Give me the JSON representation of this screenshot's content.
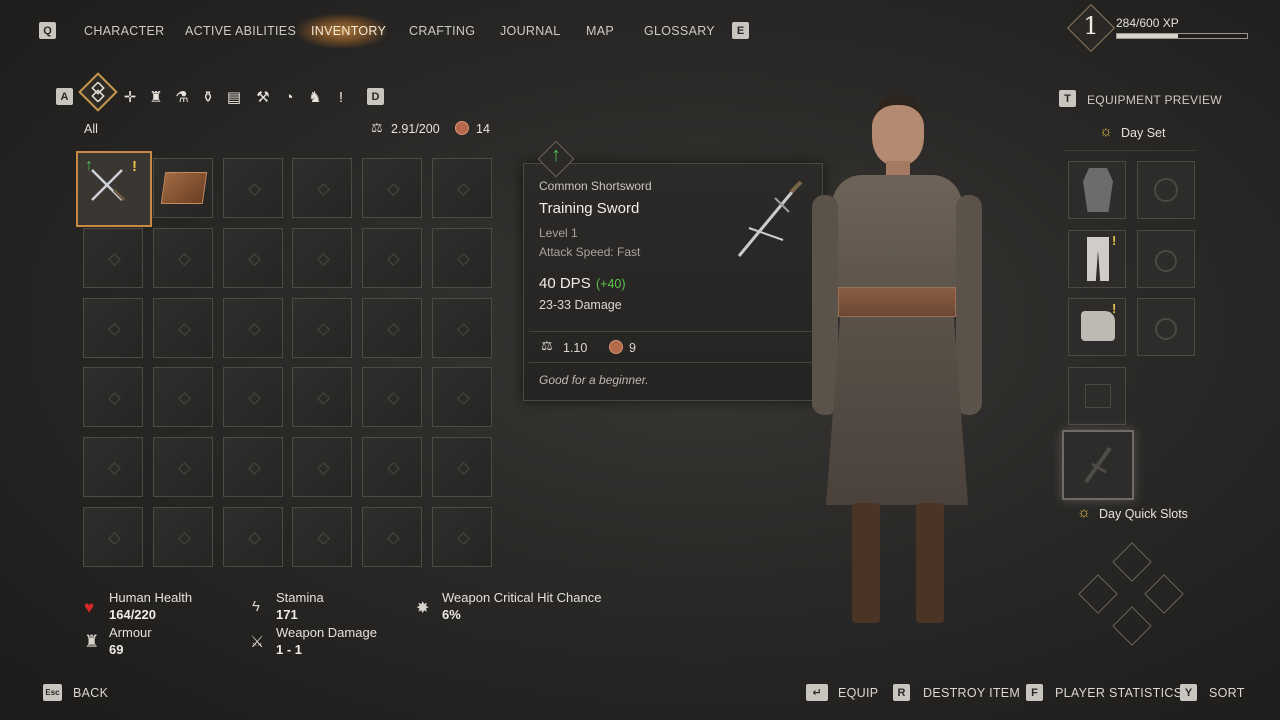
{
  "nav": {
    "left_key": "Q",
    "right_key": "E",
    "tabs": [
      "CHARACTER",
      "ACTIVE ABILITIES",
      "INVENTORY",
      "CRAFTING",
      "JOURNAL",
      "MAP",
      "GLOSSARY"
    ],
    "active": "INVENTORY"
  },
  "xp": {
    "level": "1",
    "text": "284/600 XP",
    "progress": 0.473
  },
  "filters": {
    "left_key": "A",
    "right_key": "D",
    "label": "All"
  },
  "inventory": {
    "weight": "2.91/200",
    "coins": "14"
  },
  "tooltip": {
    "rarity_type": "Common Shortsword",
    "name": "Training Sword",
    "level": "Level 1",
    "attack_speed": "Attack Speed: Fast",
    "dps": "40 DPS",
    "dps_delta": "(+40)",
    "damage": "23-33 Damage",
    "weight": "1.10",
    "value": "9",
    "description": "Good for a beginner."
  },
  "equipment": {
    "key": "T",
    "title": "EQUIPMENT PREVIEW",
    "set_label": "Day Set",
    "quick_slots_label": "Day Quick Slots"
  },
  "stats": {
    "health_label": "Human Health",
    "health_value": "164/220",
    "armour_label": "Armour",
    "armour_value": "69",
    "stamina_label": "Stamina",
    "stamina_value": "171",
    "weapon_damage_label": "Weapon Damage",
    "weapon_damage_value": "1 - 1",
    "crit_label": "Weapon Critical Hit Chance",
    "crit_value": "6%"
  },
  "footer": {
    "back_key": "Esc",
    "back_label": "BACK",
    "equip_label": "EQUIP",
    "destroy_key": "R",
    "destroy_label": "DESTROY ITEM",
    "stats_key": "F",
    "stats_label": "PLAYER STATISTICS",
    "sort_key": "Y",
    "sort_label": "SORT"
  },
  "colors": {
    "accent": "#c78a43",
    "upgrade_green": "#4fc24a",
    "health_red": "#d42a2a"
  }
}
